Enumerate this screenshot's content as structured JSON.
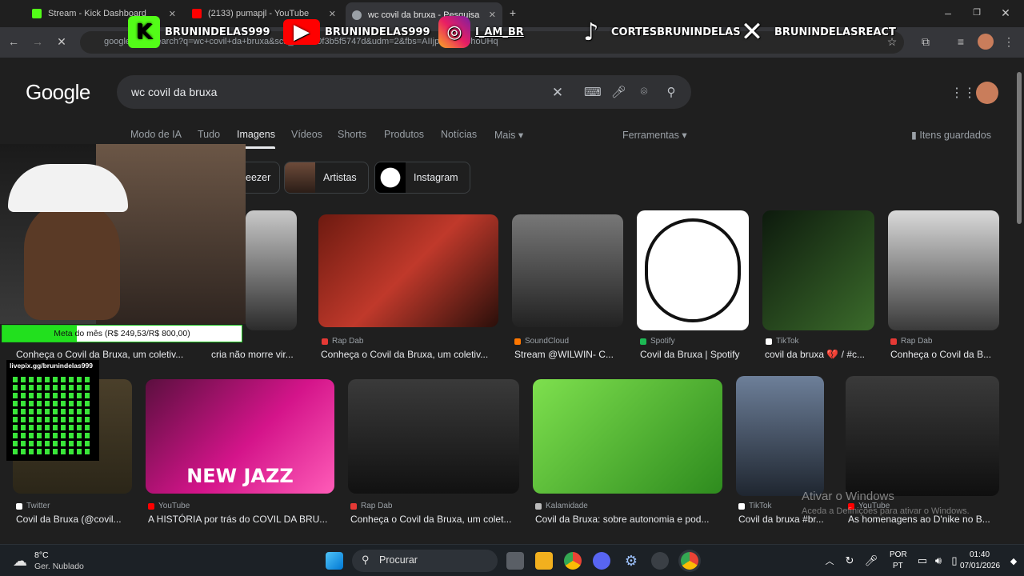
{
  "tabs": [
    {
      "title": "Stream - Kick Dashboard",
      "fav_color": "#53fc18",
      "icon": "kick-icon"
    },
    {
      "title": "(2133) pumapjl - YouTube",
      "fav_color": "#ff0000",
      "icon": "youtube-icon"
    },
    {
      "title": "wc covil da bruxa - Pesquisa Google",
      "fav_color": "#9aa0a6",
      "icon": "google-icon"
    }
  ],
  "omnibox_url": "google.com/search?q=wc+covil+da+bruxa&sca_esv=a0f3b5f5747d&udm=2&fbs=AIIjpHybk0ChoUHq",
  "overlay": [
    {
      "label": "BRUNINDELAS999",
      "icon": "kick-icon",
      "color": "#53fc18"
    },
    {
      "label": "BRUNINDELAS999",
      "icon": "youtube-icon",
      "color": "#ff0000"
    },
    {
      "label": "I_AM_BR",
      "icon": "instagram-icon",
      "color": "#c13584"
    },
    {
      "label": "CORTESBRUNINDELAS",
      "icon": "tiktok-icon",
      "color": "#000000"
    },
    {
      "label": "BRUNINDELASREACT",
      "icon": "x-icon",
      "color": "#000000"
    }
  ],
  "google": {
    "logo": "Google",
    "query": "wc covil da bruxa",
    "nav": [
      "Modo de IA",
      "Tudo",
      "Imagens",
      "Vídeos",
      "Shorts",
      "Produtos",
      "Notícias",
      "Mais"
    ],
    "tools": "Ferramentas",
    "saved": "Itens guardados",
    "chips": [
      "eezer",
      "Artistas",
      "Instagram"
    ]
  },
  "row1": [
    {
      "source": "",
      "caption": "cria não morre vir...",
      "color": "#b8b8b8"
    },
    {
      "source": "Rap Dab",
      "caption": "Conheça o Covil da Bruxa, um coletiv...",
      "color": "#9b2a1a"
    },
    {
      "source": "SoundCloud",
      "caption": "Stream @WILWIN- C...",
      "color": "#4a4a48"
    },
    {
      "source": "Spotify",
      "caption": "Covil da Bruxa | Spotify",
      "color": "#ffffff"
    },
    {
      "source": "TikTok",
      "caption": "covil da bruxa 💔 / #c...",
      "color": "#23381f"
    },
    {
      "source": "Rap Dab",
      "caption": "Conheça o Covil da B...",
      "color": "#565656"
    }
  ],
  "row1_left_caption": "Conheça o Covil da Bruxa, um coletiv...",
  "row2": [
    {
      "source": "Twitter",
      "caption": "Covil da Bruxa (@covil...",
      "color": "#3a3424"
    },
    {
      "source": "YouTube",
      "caption": "A HISTÓRIA por trás do COVIL DA BRU...",
      "color": "#b0156a",
      "overlay_text": "NEW JAZZ"
    },
    {
      "source": "Rap Dab",
      "caption": "Conheça o Covil da Bruxa, um colet...",
      "color": "#2b2b2b"
    },
    {
      "source": "Kalamidade",
      "caption": "Covil da Bruxa: sobre autonomia e pod...",
      "color": "#5fd63a"
    },
    {
      "source": "TikTok",
      "caption": "Covil da bruxa #br...",
      "color": "#3b4a5c"
    },
    {
      "source": "YouTube",
      "caption": "As homenagens ao D'nike no B...",
      "color": "#2a2a2a"
    }
  ],
  "stream": {
    "goal_label": "Meta do mês (R$ 249,53/R$ 800,00)",
    "goal_fraction": 0.312,
    "pix_url": "livepix.gg/brunindelas999"
  },
  "windows_watermark": {
    "title": "Ativar o Windows",
    "subtitle": "Aceda a Definições para ativar o Windows."
  },
  "taskbar": {
    "weather_temp": "8°C",
    "weather_desc": "Ger. Nublado",
    "search": "Procurar",
    "lang": "POR",
    "region": "PT",
    "time": "01:40",
    "date": "07/01/2026"
  }
}
